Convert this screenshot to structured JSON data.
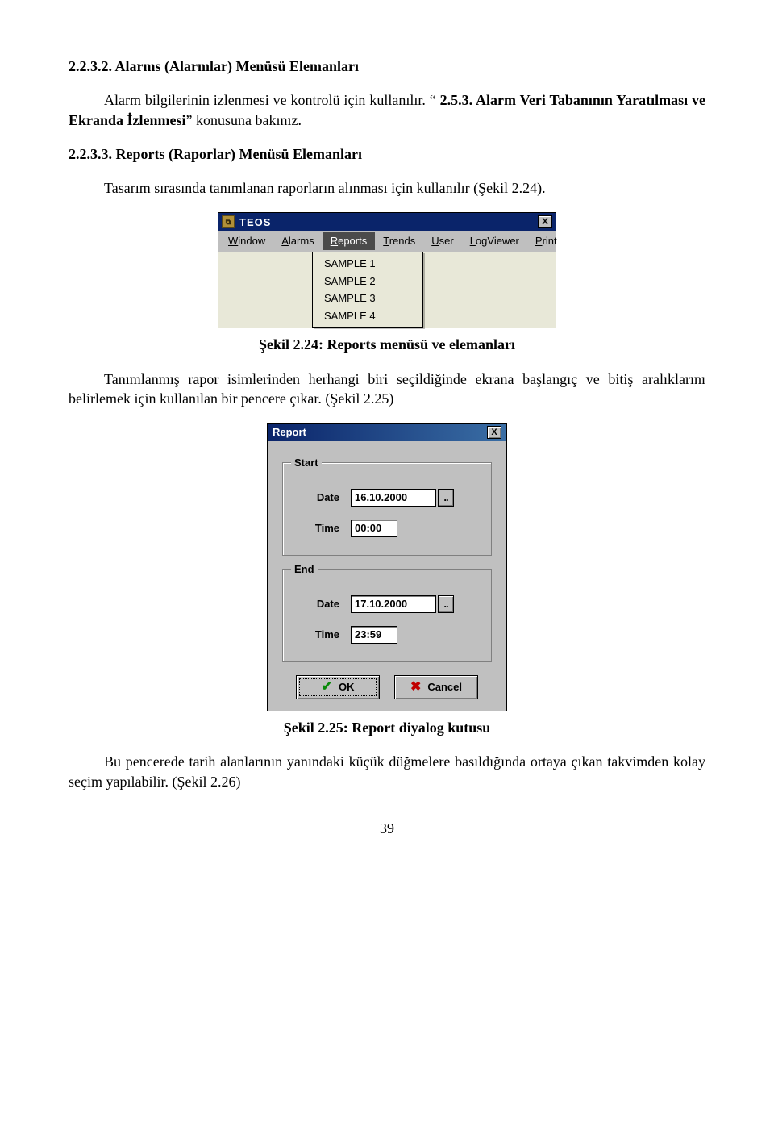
{
  "section1": {
    "heading": "2.2.3.2. Alarms (Alarmlar) Menüsü Elemanları",
    "para": "Alarm bilgilerinin izlenmesi ve kontrolü için kullanılır. \" 2.5.3. Alarm Veri Tabanının Yaratılması ve Ekranda İzlenmesi\" konusuna bakınız."
  },
  "section2": {
    "heading": "2.2.3.3. Reports (Raporlar) Menüsü Elemanları",
    "para": "Tasarım sırasında tanımlanan raporların alınması için kullanılır (Şekil 2.24)."
  },
  "teos": {
    "title": "TEOS",
    "close": "X",
    "menu": {
      "window_u": "W",
      "window_rest": "indow",
      "alarms_u": "A",
      "alarms_rest": "larms",
      "reports_u": "R",
      "reports_rest": "eports",
      "trends_u": "T",
      "trends_rest": "rends",
      "user_u": "U",
      "user_rest": "ser",
      "log_u": "L",
      "log_rest": "ogViewer",
      "print_u": "P",
      "print_rest": "rint"
    },
    "dropdown": [
      "SAMPLE 1",
      "SAMPLE 2",
      "SAMPLE 3",
      "SAMPLE 4"
    ]
  },
  "fig24": {
    "caption": "Şekil 2.24: Reports menüsü ve elemanları",
    "para_after": "Tanımlanmış rapor isimlerinden herhangi biri seçildiğinde ekrana başlangıç ve bitiş aralıklarını belirlemek için kullanılan bir pencere çıkar. (Şekil 2.25)"
  },
  "report": {
    "title": "Report",
    "close": "X",
    "start_legend": "Start",
    "end_legend": "End",
    "date_label": "Date",
    "time_label": "Time",
    "start_date": "16.10.2000",
    "start_time": "00:00",
    "end_date": "17.10.2000",
    "end_time": "23:59",
    "date_btn": "..",
    "ok": "OK",
    "cancel": "Cancel"
  },
  "fig25": {
    "caption": "Şekil 2.25: Report diyalog kutusu",
    "para_after": "Bu pencerede tarih alanlarının yanındaki küçük düğmelere basıldığında ortaya çıkan takvimden kolay seçim yapılabilir. (Şekil 2.26)"
  },
  "pagenum": "39"
}
